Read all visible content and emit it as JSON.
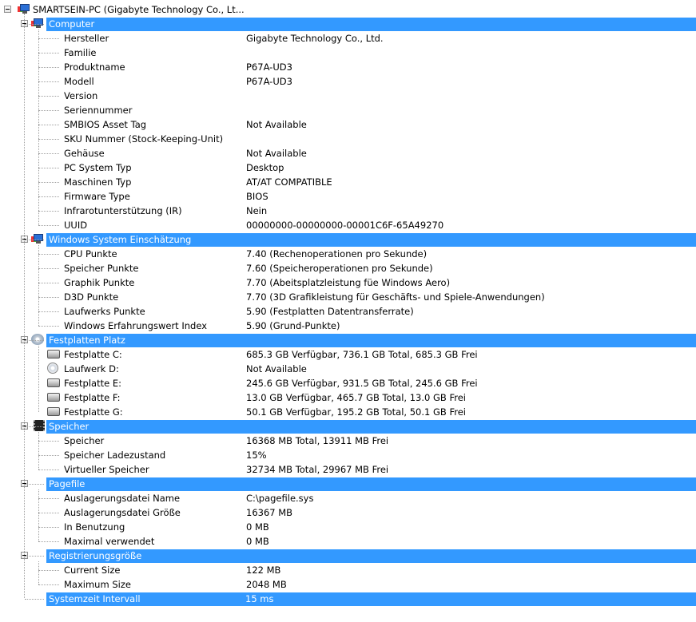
{
  "root": {
    "label": "SMARTSEIN-PC (Gigabyte Technology Co., Lt..."
  },
  "sections": [
    {
      "title": "Computer",
      "icon": "computer-icon",
      "items": [
        {
          "k": "Hersteller",
          "v": "Gigabyte Technology Co., Ltd."
        },
        {
          "k": "Familie",
          "v": ""
        },
        {
          "k": "Produktname",
          "v": "P67A-UD3"
        },
        {
          "k": "Modell",
          "v": "P67A-UD3"
        },
        {
          "k": "Version",
          "v": ""
        },
        {
          "k": "Seriennummer",
          "v": ""
        },
        {
          "k": "SMBIOS Asset Tag",
          "v": "Not Available"
        },
        {
          "k": "SKU Nummer (Stock-Keeping-Unit)",
          "v": ""
        },
        {
          "k": "Gehäuse",
          "v": "Not Available"
        },
        {
          "k": "PC System Typ",
          "v": "Desktop"
        },
        {
          "k": "Maschinen Typ",
          "v": "AT/AT COMPATIBLE"
        },
        {
          "k": "Firmware Type",
          "v": "BIOS"
        },
        {
          "k": "Infrarotunterstützung (IR)",
          "v": "Nein"
        },
        {
          "k": "UUID",
          "v": "00000000-00000000-00001C6F-65A49270"
        }
      ]
    },
    {
      "title": "Windows System Einschätzung",
      "icon": "windows-rating-icon",
      "items": [
        {
          "k": "CPU Punkte",
          "v": "7.40 (Rechenoperationen pro Sekunde)"
        },
        {
          "k": "Speicher Punkte",
          "v": "7.60 (Speicheroperationen pro Sekunde)"
        },
        {
          "k": "Graphik Punkte",
          "v": "7.70 (Abeitsplatzleistung füe Windows Aero)"
        },
        {
          "k": "D3D Punkte",
          "v": "7.70 (3D Grafikleistung für Geschäfts- und Spiele-Anwendungen)"
        },
        {
          "k": "Laufwerks Punkte",
          "v": "5.90 (Festplatten Datentransferrate)"
        },
        {
          "k": "Windows Erfahrungswert Index",
          "v": "5.90 (Grund-Punkte)"
        }
      ]
    },
    {
      "title": "Festplatten Platz",
      "icon": "disk-space-icon",
      "items": [
        {
          "k": "Festplatte C:",
          "v": "685.3 GB Verfügbar, 736.1 GB Total, 685.3 GB Frei",
          "icon": "hdd-icon"
        },
        {
          "k": "Laufwerk D:",
          "v": "Not Available",
          "icon": "cd-drive-icon"
        },
        {
          "k": "Festplatte E:",
          "v": "245.6 GB Verfügbar, 931.5 GB Total, 245.6 GB Frei",
          "icon": "hdd-icon"
        },
        {
          "k": "Festplatte F:",
          "v": "13.0 GB Verfügbar, 465.7 GB Total, 13.0 GB Frei",
          "icon": "hdd-icon"
        },
        {
          "k": "Festplatte G:",
          "v": "50.1 GB Verfügbar, 195.2 GB Total, 50.1 GB Frei",
          "icon": "hdd-icon"
        }
      ]
    },
    {
      "title": "Speicher",
      "icon": "memory-chip-icon",
      "items": [
        {
          "k": "Speicher",
          "v": "16368 MB Total, 13911 MB Frei"
        },
        {
          "k": "Speicher Ladezustand",
          "v": "15%"
        },
        {
          "k": "Virtueller Speicher",
          "v": "32734 MB Total, 29967 MB Frei"
        }
      ]
    },
    {
      "title": "Pagefile",
      "icon": "",
      "items": [
        {
          "k": "Auslagerungsdatei Name",
          "v": "C:\\pagefile.sys"
        },
        {
          "k": "Auslagerungsdatei Größe",
          "v": "16367 MB"
        },
        {
          "k": "In Benutzung",
          "v": "0 MB"
        },
        {
          "k": "Maximal verwendet",
          "v": "0 MB"
        }
      ]
    },
    {
      "title": "Registrierungsgröße",
      "icon": "",
      "items": [
        {
          "k": "Current Size",
          "v": "122 MB"
        },
        {
          "k": "Maximum Size",
          "v": "2048 MB"
        }
      ]
    },
    {
      "title": "Systemzeit Intervall",
      "icon": "",
      "value": "15 ms",
      "items": []
    }
  ]
}
